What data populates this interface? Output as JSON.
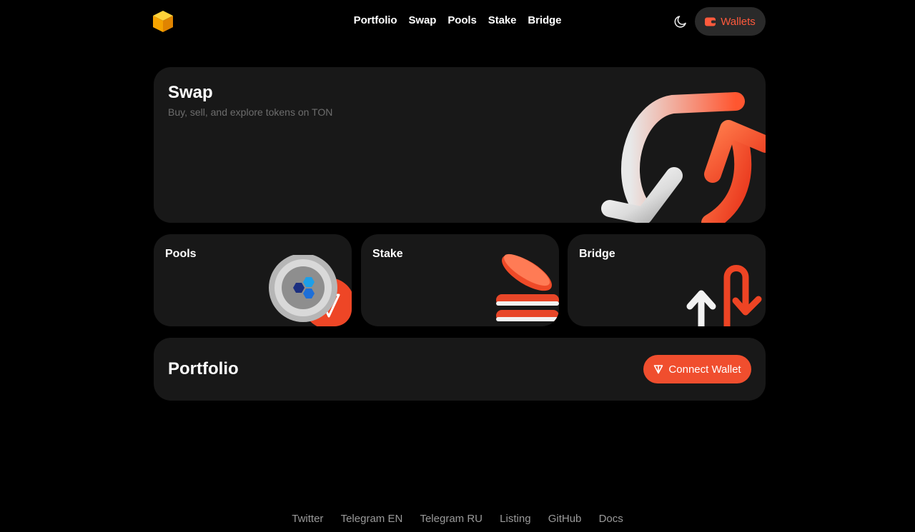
{
  "header": {
    "logo_icon": "cube-logo-icon",
    "nav": [
      "Portfolio",
      "Swap",
      "Pools",
      "Stake",
      "Bridge"
    ],
    "theme_icon": "moon-icon",
    "wallets_icon": "wallet-icon",
    "wallets_label": "Wallets"
  },
  "swap_card": {
    "title": "Swap",
    "subtitle": "Buy, sell, and explore tokens on TON"
  },
  "cards": {
    "pools": "Pools",
    "stake": "Stake",
    "bridge": "Bridge"
  },
  "portfolio": {
    "title": "Portfolio",
    "connect_icon": "ton-icon",
    "connect_label": "Connect Wallet"
  },
  "footer": [
    "Twitter",
    "Telegram EN",
    "Telegram RU",
    "Listing",
    "GitHub",
    "Docs"
  ],
  "colors": {
    "accent": "#f04e2e",
    "background": "#000000",
    "card": "#181818",
    "muted_text": "#6d6d6d"
  }
}
